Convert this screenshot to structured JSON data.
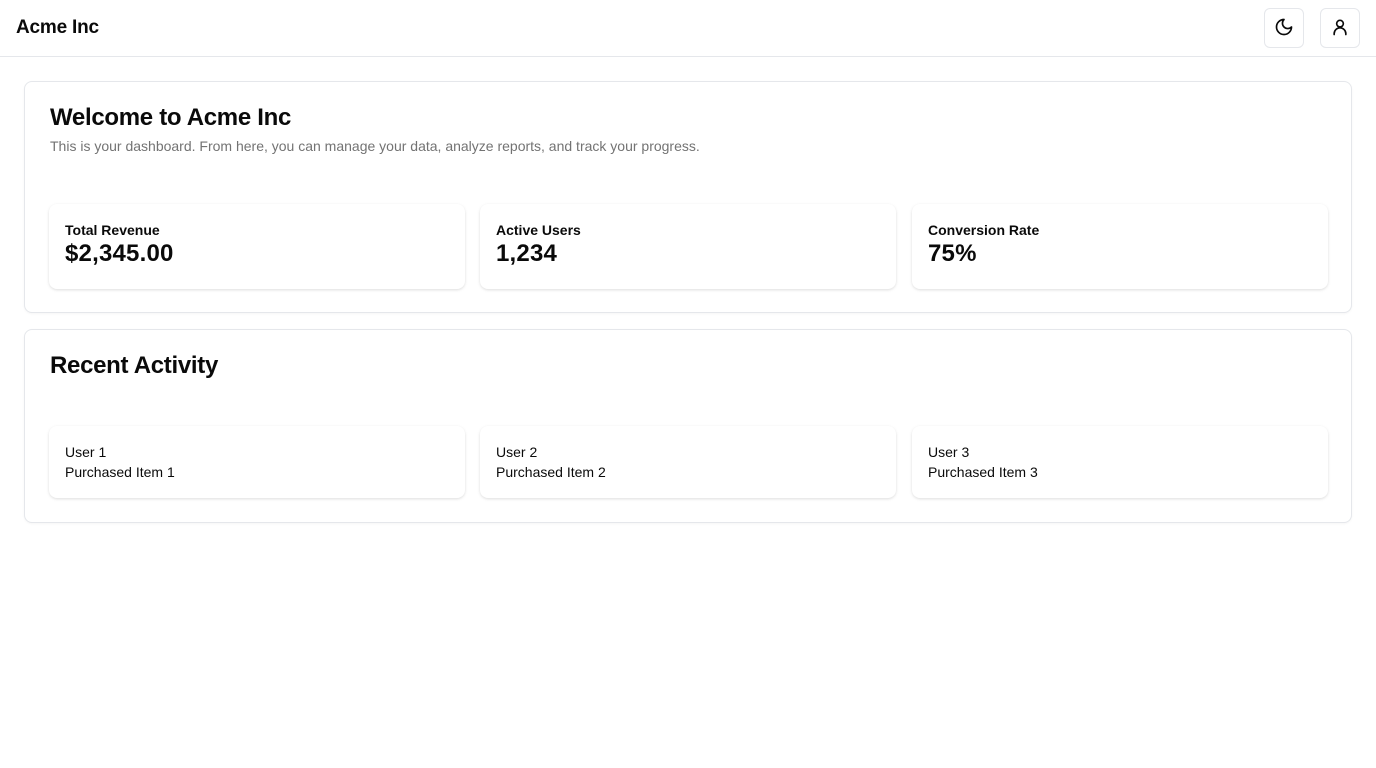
{
  "header": {
    "brand": "Acme Inc",
    "theme_icon": "moon-icon",
    "user_icon": "user-icon"
  },
  "welcome": {
    "title": "Welcome to Acme Inc",
    "subtitle": "This is your dashboard. From here, you can manage your data, analyze reports, and track your progress.",
    "stats": [
      {
        "label": "Total Revenue",
        "value": "$2,345.00"
      },
      {
        "label": "Active Users",
        "value": "1,234"
      },
      {
        "label": "Conversion Rate",
        "value": "75%"
      }
    ]
  },
  "activity": {
    "title": "Recent Activity",
    "items": [
      {
        "user": "User 1",
        "action": "Purchased Item 1"
      },
      {
        "user": "User 2",
        "action": "Purchased Item 2"
      },
      {
        "user": "User 3",
        "action": "Purchased Item 3"
      }
    ]
  }
}
